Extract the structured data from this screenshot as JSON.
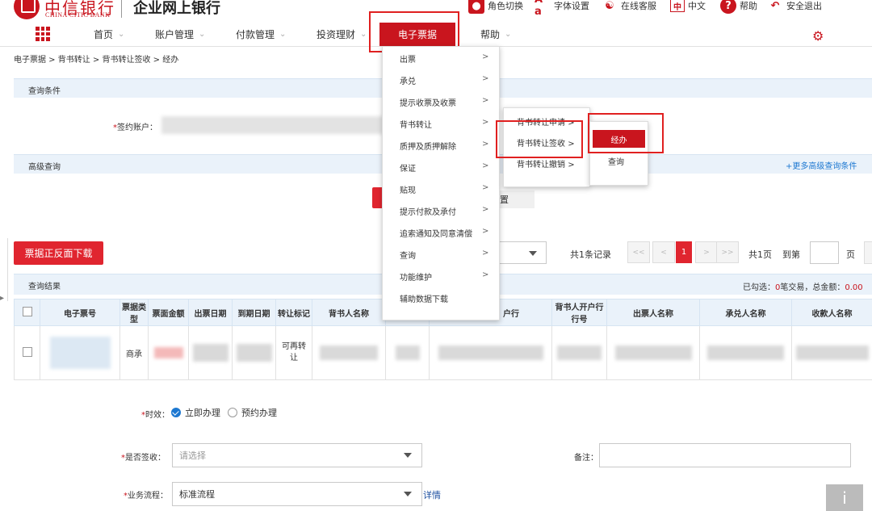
{
  "bank": {
    "name_cn": "中信银行",
    "name_en": "CHINA CITIC BANK",
    "app_title": "企业网上银行"
  },
  "toolbar": {
    "role_switch": "角色切换",
    "font_settings": "字体设置",
    "online_service": "在线客服",
    "language": "中文",
    "help": "帮助",
    "logout": "安全退出"
  },
  "nav": {
    "home": "首页",
    "account": "账户管理",
    "payment": "付款管理",
    "invest": "投资理财",
    "ebill": "电子票据",
    "help": "帮助"
  },
  "breadcrumb": "电子票据 > 背书转让 > 背书转让签收 > 经办",
  "query": {
    "section_title": "查询条件",
    "account_label": "签约账户：",
    "advanced_title": "高级查询",
    "more_conditions": "+更多高级查询条件",
    "reset_partial": "置"
  },
  "actions": {
    "download_button": "票据正反面下载"
  },
  "pager": {
    "total_records": "共1条记录",
    "current_page": "1",
    "total_pages": "共1页",
    "goto": "到第",
    "page_unit": "页",
    "first": "<<",
    "prev": "<",
    "next": ">",
    "last": ">>"
  },
  "results": {
    "title": "查询结果",
    "summary_prefix": "已勾选：",
    "summary_count": "0",
    "summary_mid": "笔交易，总金额：",
    "summary_amount": "0.00",
    "headers": [
      "电子票号",
      "票据类型",
      "票面金额",
      "出票日期",
      "到期日期",
      "转让标记",
      "背书人名称",
      "",
      "户行",
      "背书人开户行行号",
      "出票人名称",
      "承兑人名称",
      "收款人名称"
    ],
    "row": {
      "bill_type": "商承",
      "transfer_flag": "可再转让"
    }
  },
  "menu": {
    "items": [
      {
        "label": "出票",
        "arrow": ">"
      },
      {
        "label": "承兑",
        "arrow": ">"
      },
      {
        "label": "提示收票及收票",
        "arrow": ">"
      },
      {
        "label": "背书转让",
        "arrow": ">"
      },
      {
        "label": "质押及质押解除",
        "arrow": ">"
      },
      {
        "label": "保证",
        "arrow": ">"
      },
      {
        "label": "贴现",
        "arrow": ">"
      },
      {
        "label": "提示付款及承付",
        "arrow": ">"
      },
      {
        "label": "追索通知及同意清偿",
        "arrow": ">"
      },
      {
        "label": "查询",
        "arrow": ">"
      },
      {
        "label": "功能维护",
        "arrow": ">"
      },
      {
        "label": "辅助数据下载",
        "arrow": ""
      }
    ],
    "sub_items": [
      {
        "label": "背书转让申请",
        "arrow": ">"
      },
      {
        "label": "背书转让签收",
        "arrow": ">"
      },
      {
        "label": "背书转让撤销",
        "arrow": ">"
      }
    ],
    "sub2_items": [
      {
        "label": "经办"
      },
      {
        "label": "查询"
      }
    ]
  },
  "form": {
    "timing_label": "时效：",
    "timing_immediate": "立即办理",
    "timing_scheduled": "预约办理",
    "sign_label": "是否签收：",
    "sign_placeholder": "请选择",
    "remark_label": "备注：",
    "flow_label": "业务流程：",
    "flow_value": "标准流程",
    "detail_link": "详情"
  },
  "colors": {
    "brand": "#c9151e",
    "header_bg": "#eaf2fa",
    "link": "#1d78d1"
  }
}
